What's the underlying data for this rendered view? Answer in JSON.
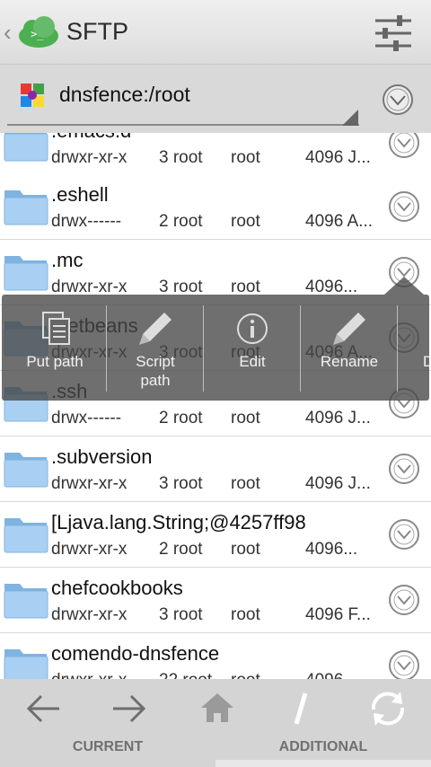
{
  "header": {
    "title": "SFTP",
    "back_icon": "chevron-left-icon",
    "logo_icon": "cloud-terminal-icon",
    "settings_icon": "sliders-icon"
  },
  "connection": {
    "label": "dnsfence:/root",
    "icon": "grid-color-icon",
    "menu_icon": "circle-chevron-down-icon"
  },
  "files": [
    {
      "name": ".emacs.d",
      "perms": "drwxr-xr-x",
      "owner": "3 root",
      "group": "root",
      "size": "4096 J..."
    },
    {
      "name": ".eshell",
      "perms": "drwx------",
      "owner": "2 root",
      "group": "root",
      "size": "4096 A..."
    },
    {
      "name": ".mc",
      "perms": "drwxr-xr-x",
      "owner": "3 root",
      "group": "root",
      "size": "4096..."
    },
    {
      "name": ".netbeans",
      "perms": "drwxr-xr-x",
      "owner": "3 root",
      "group": "root",
      "size": "4096 A..."
    },
    {
      "name": ".ssh",
      "perms": "drwx------",
      "owner": "2 root",
      "group": "root",
      "size": "4096 J..."
    },
    {
      "name": ".subversion",
      "perms": "drwxr-xr-x",
      "owner": "3 root",
      "group": "root",
      "size": "4096 J..."
    },
    {
      "name": "[Ljava.lang.String;@4257ff98",
      "perms": "drwxr-xr-x",
      "owner": "2 root",
      "group": "root",
      "size": "4096..."
    },
    {
      "name": "chefcookbooks",
      "perms": "drwxr-xr-x",
      "owner": "3 root",
      "group": "root",
      "size": "4096 F..."
    },
    {
      "name": "comendo-dnsfence",
      "perms": "drwxr-xr-x",
      "owner": "22 root",
      "group": "root",
      "size": "4096..."
    }
  ],
  "popup": {
    "items": [
      {
        "label": "Put path",
        "icon": "copy-document-icon"
      },
      {
        "label": "Script path",
        "icon": "pencil-icon"
      },
      {
        "label": "Edit",
        "icon": "info-icon"
      },
      {
        "label": "Rename",
        "icon": "pencil-icon"
      },
      {
        "label": "D",
        "icon": "delete-icon"
      }
    ]
  },
  "bottom": {
    "buttons": [
      "back-arrow-icon",
      "forward-arrow-icon",
      "home-icon",
      "root-slash-icon",
      "refresh-icon"
    ],
    "tabs": [
      "CURRENT",
      "ADDITIONAL"
    ],
    "active_tab_color": "#33b5e5"
  }
}
